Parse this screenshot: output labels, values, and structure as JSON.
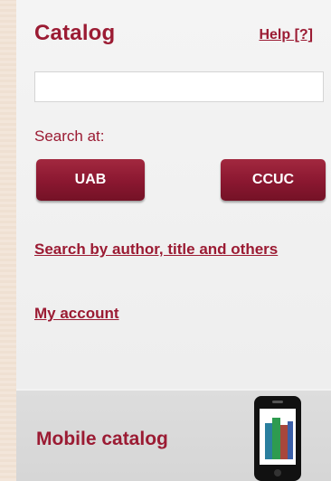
{
  "catalog": {
    "title": "Catalog",
    "help_label": "Help [?]"
  },
  "search": {
    "value": "",
    "placeholder": ""
  },
  "search_at": {
    "label": "Search at:",
    "buttons": [
      {
        "label": "UAB"
      },
      {
        "label": "CCUC"
      }
    ]
  },
  "links": {
    "search_by": "Search by author, title and others",
    "my_account": "My account"
  },
  "mobile": {
    "label": "Mobile catalog",
    "icon": "mobile-phone-books-icon"
  },
  "colors": {
    "brand": "#9b1b33",
    "button": "#8a1730",
    "panel": "#f3f3f3",
    "mobile_section": "#d9d9d9"
  }
}
